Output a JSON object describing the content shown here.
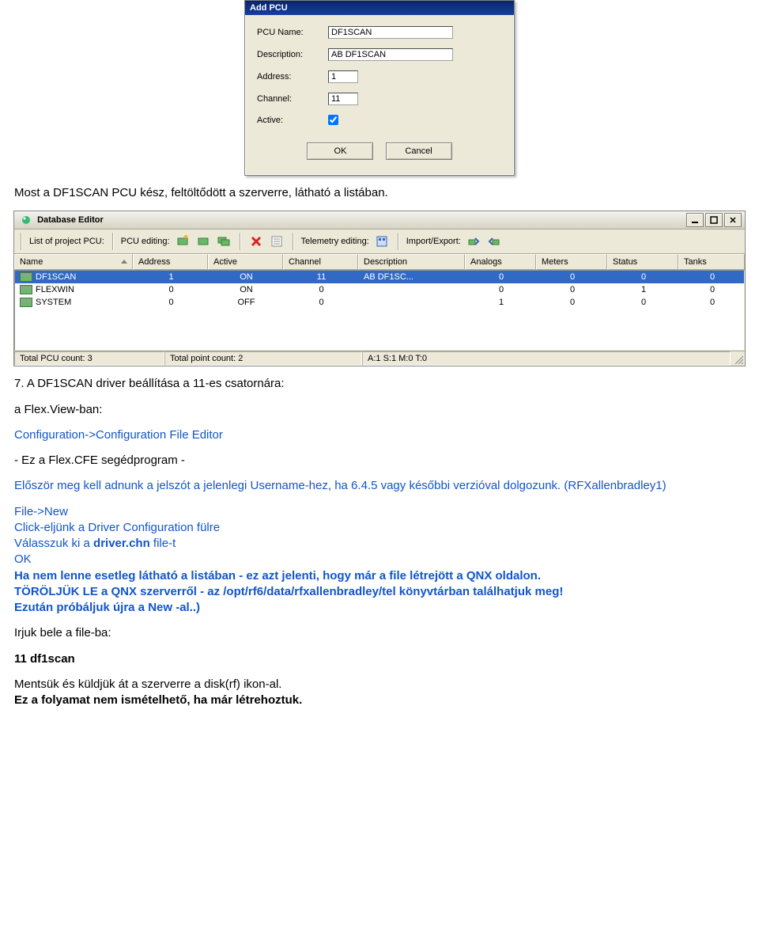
{
  "dialog": {
    "title": "Add PCU",
    "labels": {
      "pcu_name": "PCU Name:",
      "description": "Description:",
      "address": "Address:",
      "channel": "Channel:",
      "active": "Active:"
    },
    "values": {
      "pcu_name": "DF1SCAN",
      "description": "AB DF1SCAN",
      "address": "1",
      "channel": "11",
      "active": true
    },
    "buttons": {
      "ok": "OK",
      "cancel": "Cancel"
    }
  },
  "text": {
    "p1": "Most a DF1SCAN PCU kész, feltöltődött a szerverre, látható a listában.",
    "h2": "7. A DF1SCAN driver beállítása a 11-es csatornára:",
    "flexview": "a Flex.View-ban:",
    "cfe_path": "Configuration->Configuration File Editor",
    "cfe_note": "- Ez a Flex.CFE segédprogram -",
    "pw_line": "Először meg kell adnunk a jelszót a jelenlegi Username-hez, ha 6.4.5 vagy későbbi verzióval dolgozunk. (RFXallenbradley1)",
    "file_new": "File->New",
    "click_tab": "Click-eljünk a Driver Configuration fülre",
    "select_file_pre": "Válasszuk ki a ",
    "select_file_bold": "driver.chn",
    "select_file_post": " file-t",
    "ok": "OK",
    "warn1": "Ha nem lenne esetleg látható a listában - ez azt jelenti, hogy már a file létrejött a QNX oldalon.",
    "warn2": "TÖRÖLJÜK LE a QNX szerverről - az /opt/rf6/data/rfxallenbradley/tel könyvtárban találhatjuk meg!",
    "warn3": "Ezután próbáljuk újra a New -al..)",
    "irjuk": "Irjuk bele a file-ba:",
    "code": "11 df1scan",
    "save1": "Mentsük és küldjük át a szerverre a disk(rf) ikon-al.",
    "save2": "Ez a folyamat nem ismételhető, ha már létrehoztuk."
  },
  "dbeditor": {
    "title": "Database Editor",
    "toolbar": {
      "list_label": "List of project PCU:",
      "pcu_edit": "PCU editing:",
      "telemetry": "Telemetry editing:",
      "import_export": "Import/Export:"
    },
    "columns": [
      "Name",
      "Address",
      "Active",
      "Channel",
      "Description",
      "Analogs",
      "Meters",
      "Status",
      "Tanks"
    ],
    "rows": [
      {
        "name": "DF1SCAN",
        "address": "1",
        "active": "ON",
        "channel": "11",
        "description": "AB DF1SC...",
        "analogs": "0",
        "meters": "0",
        "status": "0",
        "tanks": "0",
        "selected": true
      },
      {
        "name": "FLEXWIN",
        "address": "0",
        "active": "ON",
        "channel": "0",
        "description": "",
        "analogs": "0",
        "meters": "0",
        "status": "1",
        "tanks": "0",
        "selected": false
      },
      {
        "name": "SYSTEM",
        "address": "0",
        "active": "OFF",
        "channel": "0",
        "description": "",
        "analogs": "1",
        "meters": "0",
        "status": "0",
        "tanks": "0",
        "selected": false
      }
    ],
    "status": {
      "total_pcu": "Total PCU count: 3",
      "total_point": "Total point count: 2",
      "coords": "A:1  S:1  M:0  T:0"
    }
  }
}
